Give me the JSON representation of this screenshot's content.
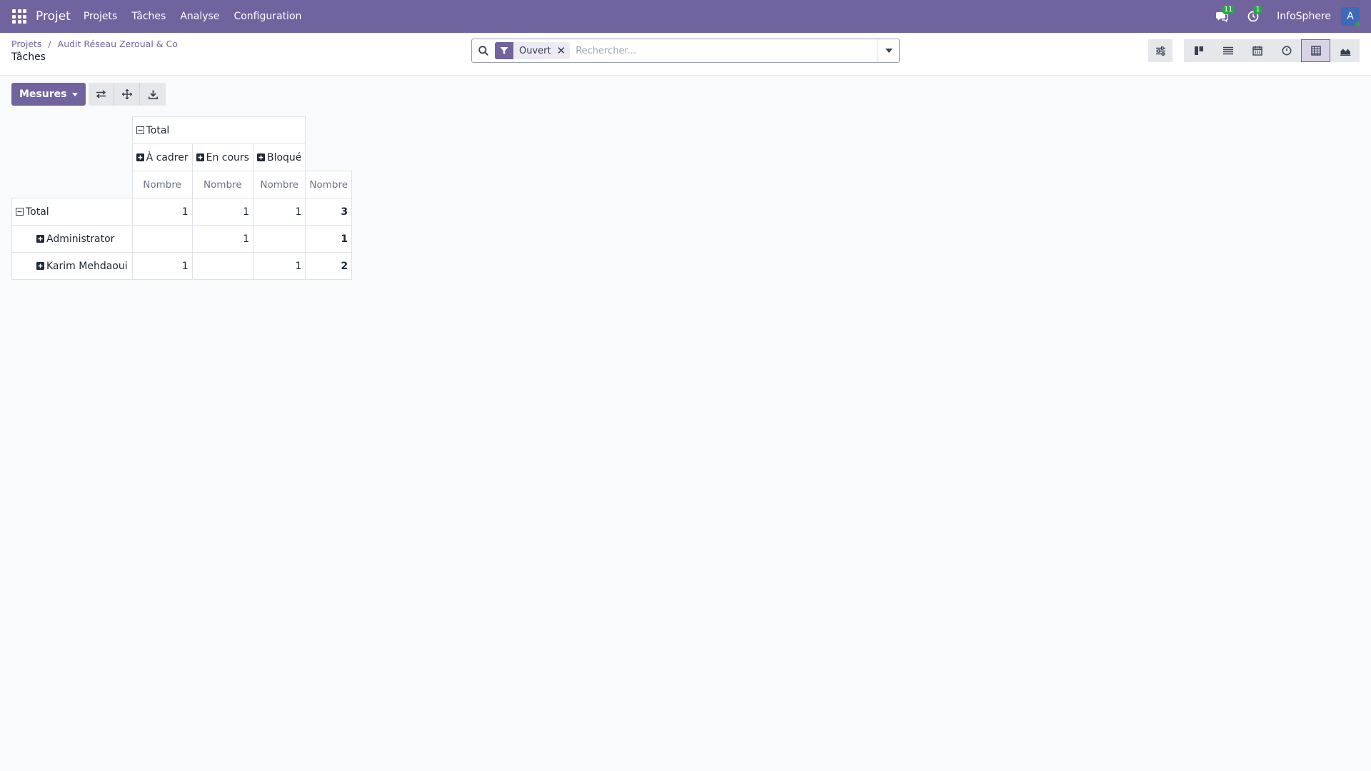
{
  "navbar": {
    "app_name": "Projet",
    "menu": [
      "Projets",
      "Tâches",
      "Analyse",
      "Configuration"
    ],
    "messages_badge": "11",
    "activities_badge": "1",
    "company": "InfoSphere",
    "avatar_initial": "A",
    "accent_color": "#71639e"
  },
  "control_panel": {
    "breadcrumb": [
      "Projets",
      "Audit Réseau Zeroual & Co"
    ],
    "title": "Tâches",
    "search": {
      "facet_label": "Ouvert",
      "placeholder": "Rechercher..."
    },
    "views": [
      "kanban",
      "list",
      "calendar",
      "activity",
      "pivot",
      "graph"
    ],
    "active_view": "pivot"
  },
  "toolbar": {
    "measures_label": "Mesures"
  },
  "pivot": {
    "col_total": "Total",
    "col_groups": [
      "À cadrer",
      "En cours",
      "Bloqué"
    ],
    "measure": "Nombre",
    "row_total": "Total",
    "total_values": [
      "1",
      "1",
      "1",
      "3"
    ],
    "rows": [
      {
        "label": "Administrator",
        "values": [
          "",
          "1",
          "",
          "1"
        ]
      },
      {
        "label": "Karim Mehdaoui",
        "values": [
          "1",
          "",
          "1",
          "2"
        ]
      }
    ]
  }
}
